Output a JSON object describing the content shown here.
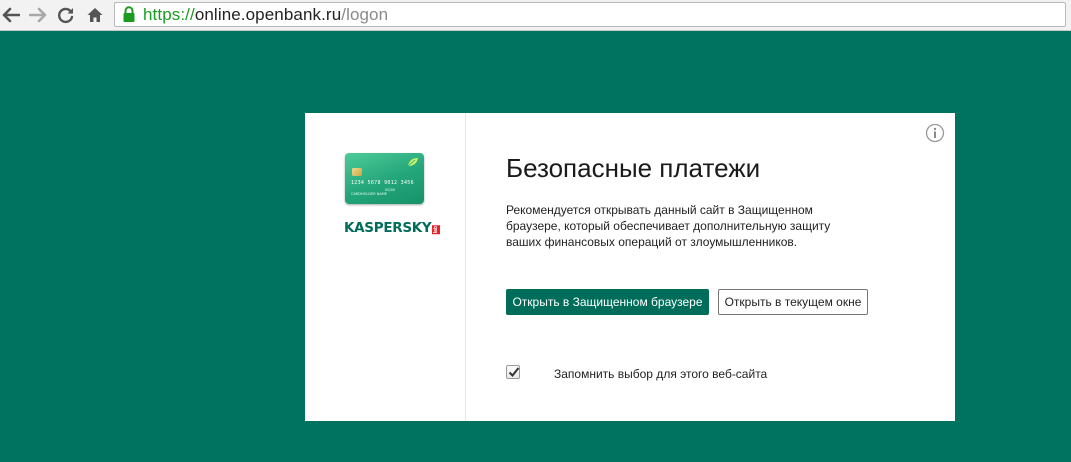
{
  "browser": {
    "url_scheme": "https://",
    "url_host": "online.openbank.ru",
    "url_path": "/logon",
    "icons": [
      "back-icon",
      "forward-icon",
      "reload-icon",
      "home-icon",
      "lock-icon"
    ]
  },
  "dialog": {
    "title": "Безопасные платежи",
    "description": "Рекомендуется открывать данный сайт в Защищенном браузере, который обеспечивает дополнительную защиту ваших финансовых операций от злоумышленников.",
    "primary_button": "Открыть в Защищенном браузере",
    "secondary_button": "Открыть в текущем окне",
    "remember_label": "Запомнить выбор для этого веб-сайта",
    "remember_checked": true,
    "info_icon": "info-icon"
  },
  "branding": {
    "logo_text": "KASPERSKY",
    "logo_suffix": "lab",
    "card_number": "1234 5678 9012 3456",
    "card_holder": "CARDHOLDER NAME",
    "card_thru": "00/00"
  },
  "colors": {
    "background": "#007360",
    "primary": "#006d5b",
    "url_secure": "#1c9b20"
  }
}
